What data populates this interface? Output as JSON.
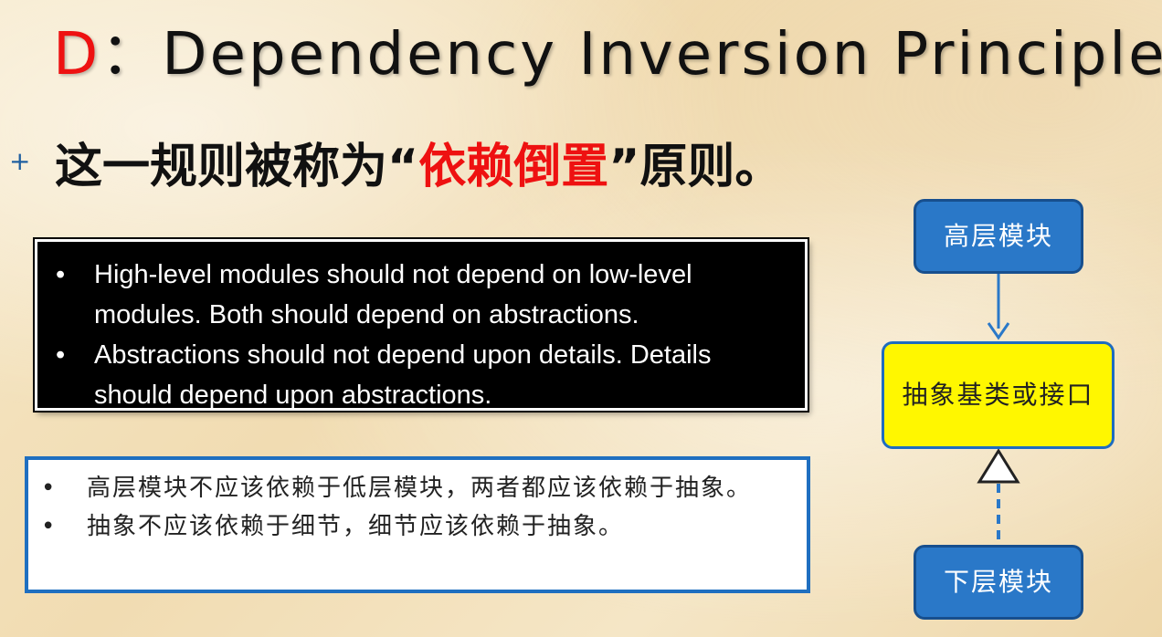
{
  "title": {
    "letter": "D",
    "separator": "：",
    "text": "Dependency Inversion Principle"
  },
  "heading": {
    "bullet": "+",
    "prefix": "这一规则被称为",
    "open_quote": "“",
    "highlight": "依赖倒置",
    "close_quote": "”",
    "suffix": "原则。"
  },
  "english_box": {
    "items": [
      "High-level modules should not depend on low-level modules. Both should depend on abstractions.",
      "Abstractions should not depend upon details. Details should depend upon abstractions."
    ]
  },
  "chinese_box": {
    "items": [
      "高层模块不应该依赖于低层模块，两者都应该依赖于抽象。",
      "抽象不应该依赖于细节，细节应该依赖于抽象。"
    ]
  },
  "diagram": {
    "high_module": "高层模块",
    "abstraction": "抽象基类或接口",
    "low_module": "下层模块"
  },
  "colors": {
    "accent_red": "#ee1111",
    "node_blue": "#2a78c8",
    "node_yellow": "#fff700",
    "frame_blue": "#1f6fc0"
  }
}
